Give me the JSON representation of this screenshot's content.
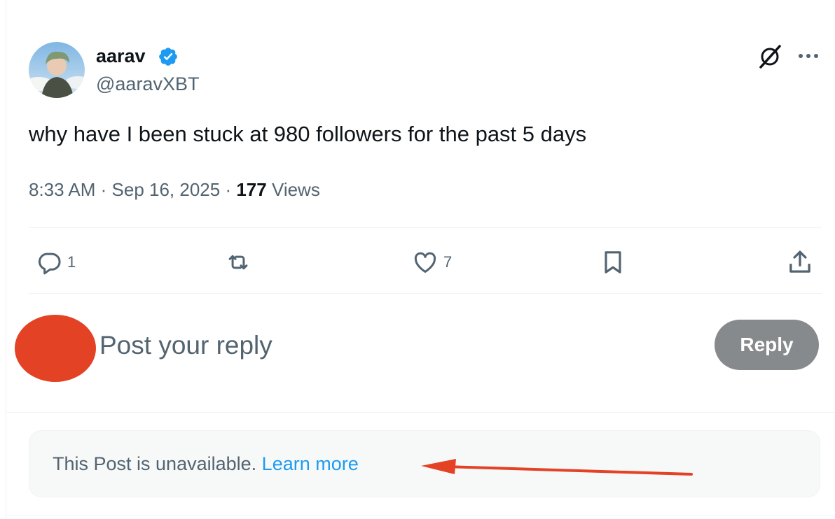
{
  "author": {
    "display_name": "aarav",
    "handle": "@aaravXBT",
    "verified": true
  },
  "tweet": {
    "text": "why have I been stuck at 980 followers for the past 5 days",
    "time": "8:33 AM",
    "date": "Sep 16, 2025",
    "views_count": "177",
    "views_label": "Views"
  },
  "actions": {
    "reply_count": "1",
    "retweet_count": "",
    "like_count": "7"
  },
  "composer": {
    "placeholder": "Post your reply",
    "button_label": "Reply"
  },
  "notice": {
    "text": "This Post is unavailable.",
    "link": "Learn more"
  },
  "colors": {
    "text_primary": "#0f1419",
    "text_secondary": "#536471",
    "verified_badge": "#1d9bf0",
    "link": "#1d9bf0",
    "reply_button": "#878a8c",
    "annotation_red": "#e34224"
  },
  "icons": [
    "verified-badge-icon",
    "grok-icon",
    "more-icon",
    "reply-icon",
    "retweet-icon",
    "like-icon",
    "bookmark-icon",
    "share-icon",
    "red-arrow-annotation"
  ]
}
